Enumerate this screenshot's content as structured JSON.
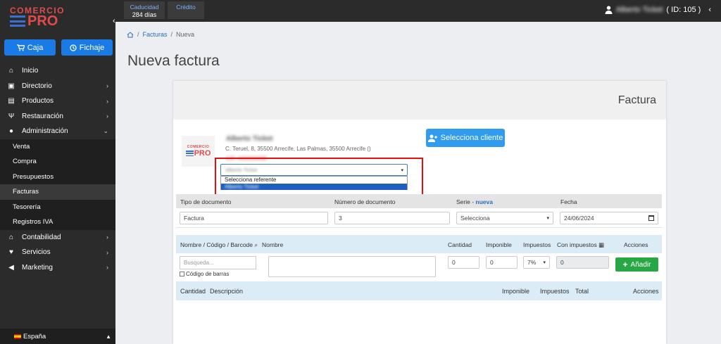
{
  "brand": {
    "line1": "COMERCIO",
    "line2": "PRO"
  },
  "sidebar": {
    "buttons": [
      {
        "label": "Caja",
        "icon": "cart-icon"
      },
      {
        "label": "Fichaje",
        "icon": "clock-icon"
      }
    ],
    "items": [
      {
        "label": "Inicio",
        "icon": "home-icon"
      },
      {
        "label": "Directorio",
        "icon": "contact-book-icon"
      },
      {
        "label": "Productos",
        "icon": "box-icon"
      },
      {
        "label": "Restauración",
        "icon": "cutlery-icon"
      },
      {
        "label": "Administración",
        "icon": "users-icon"
      }
    ],
    "subitems": [
      "Venta",
      "Compra",
      "Presupuestos",
      "Facturas",
      "Tesorería",
      "Registros IVA"
    ],
    "items_after": [
      {
        "label": "Contabilidad",
        "icon": "bank-icon"
      },
      {
        "label": "Servicios",
        "icon": "heart-hand-icon"
      },
      {
        "label": "Marketing",
        "icon": "megaphone-icon"
      }
    ],
    "language": "España"
  },
  "topbar": {
    "tabs": [
      {
        "title": "Caducidad",
        "value": "284 días"
      },
      {
        "title": "Crédito",
        "value": ""
      }
    ],
    "user_name": "Alberto Ticket",
    "user_id": "( ID: 105 )"
  },
  "breadcrumb": {
    "item1": "Facturas",
    "item2": "Nueva",
    "sep": "/"
  },
  "page_title": "Nueva factura",
  "card": {
    "title": "Factura",
    "client": {
      "name": "Alberto Ticket",
      "address": "C. Teruel, 8, 35500 Arrecife, Las Palmas, 35500 Arrecife ()",
      "cif": "CIF: 00000000E"
    },
    "select_client_label": "Selecciona cliente",
    "referente": {
      "value": "Alberto Ticket",
      "options": [
        "Selecciona referente",
        "Alberto Ticket"
      ]
    },
    "doc": {
      "headers": {
        "tipo": "Tipo de documento",
        "numero": "Número de documento",
        "serie": "Serie - ",
        "serie_link": "nueva",
        "fecha": "Fecha"
      },
      "values": {
        "tipo": "Factura",
        "numero": "3",
        "serie": "Selecciona",
        "fecha": "24/06/2024"
      }
    },
    "lines": {
      "headers": {
        "busqueda": "Nombre / Código / Barcode",
        "nombre": "Nombre",
        "cantidad": "Cantidad",
        "imponible": "Imponible",
        "impuestos": "Impuestos",
        "con_impuestos": "Con impuestos",
        "acciones": "Acciones"
      },
      "search_placeholder": "Busqueda...",
      "barcode_label": "Código de barras",
      "cantidad": "0",
      "imponible": "0",
      "impuesto": "7%",
      "con_impuestos": "0",
      "add_label": "Añadir"
    },
    "totals": {
      "cantidad": "Cantidad",
      "descripcion": "Descripción",
      "imponible": "Imponible",
      "impuestos": "Impuestos",
      "total": "Total",
      "acciones": "Acciones"
    }
  },
  "colors": {
    "primary": "#1a7be6",
    "sidebar": "#2b2b2b",
    "accent_red": "#e31010",
    "success": "#28a745"
  }
}
